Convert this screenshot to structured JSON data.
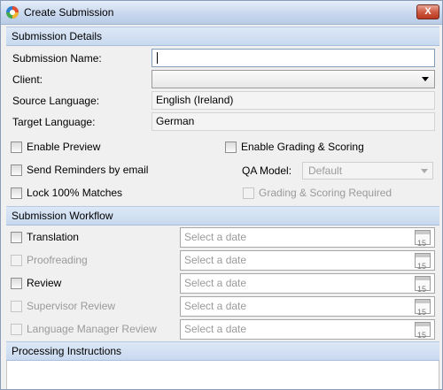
{
  "window": {
    "title": "Create Submission",
    "close_label": "X"
  },
  "details": {
    "header": "Submission Details",
    "submission_name_label": "Submission Name:",
    "submission_name_value": "",
    "client_label": "Client:",
    "client_value": "",
    "source_language_label": "Source Language:",
    "source_language_value": "English (Ireland)",
    "target_language_label": "Target Language:",
    "target_language_value": "German"
  },
  "options": {
    "enable_preview": "Enable Preview",
    "send_reminders": "Send Reminders by email",
    "lock_matches": "Lock 100% Matches",
    "enable_grading": "Enable Grading & Scoring",
    "qa_model_label": "QA Model:",
    "qa_model_value": "Default",
    "grading_required": "Grading & Scoring Required"
  },
  "workflow": {
    "header": "Submission Workflow",
    "date_placeholder": "Select a date",
    "calendar_day": "15",
    "steps": [
      {
        "label": "Translation",
        "enabled": true
      },
      {
        "label": "Proofreading",
        "enabled": false
      },
      {
        "label": "Review",
        "enabled": true
      },
      {
        "label": "Supervisor Review",
        "enabled": false
      },
      {
        "label": "Language Manager Review",
        "enabled": false
      }
    ]
  },
  "instructions": {
    "header": "Processing Instructions"
  }
}
